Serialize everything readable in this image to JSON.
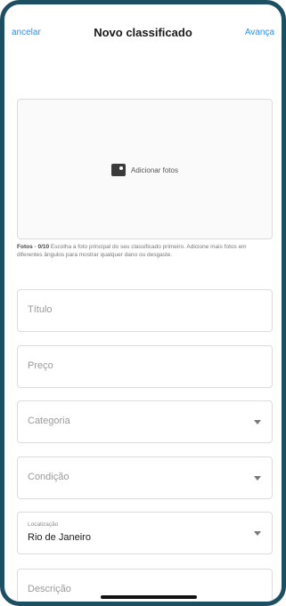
{
  "header": {
    "cancel_label": "ancelar",
    "title": "Novo classificado",
    "next_label": "Avança"
  },
  "photos": {
    "add_label": "Adicionar fotos",
    "icon": "add-photo-icon",
    "hint_bold": "Fotos · 0/10",
    "hint_text": " Escolha a foto principal do seu classificado primeiro. Adicione mais fotos em diferentes ângulos para mostrar qualquer dano ou desgaste."
  },
  "form": {
    "title_placeholder": "Título",
    "price_placeholder": "Preço",
    "category_placeholder": "Categoria",
    "condition_placeholder": "Condição",
    "location_label": "Localização",
    "location_value": "Rio de Janeiro",
    "description_placeholder": "Descrição"
  },
  "colors": {
    "accent": "#2d8ef0",
    "frame": "#1d4f63"
  }
}
